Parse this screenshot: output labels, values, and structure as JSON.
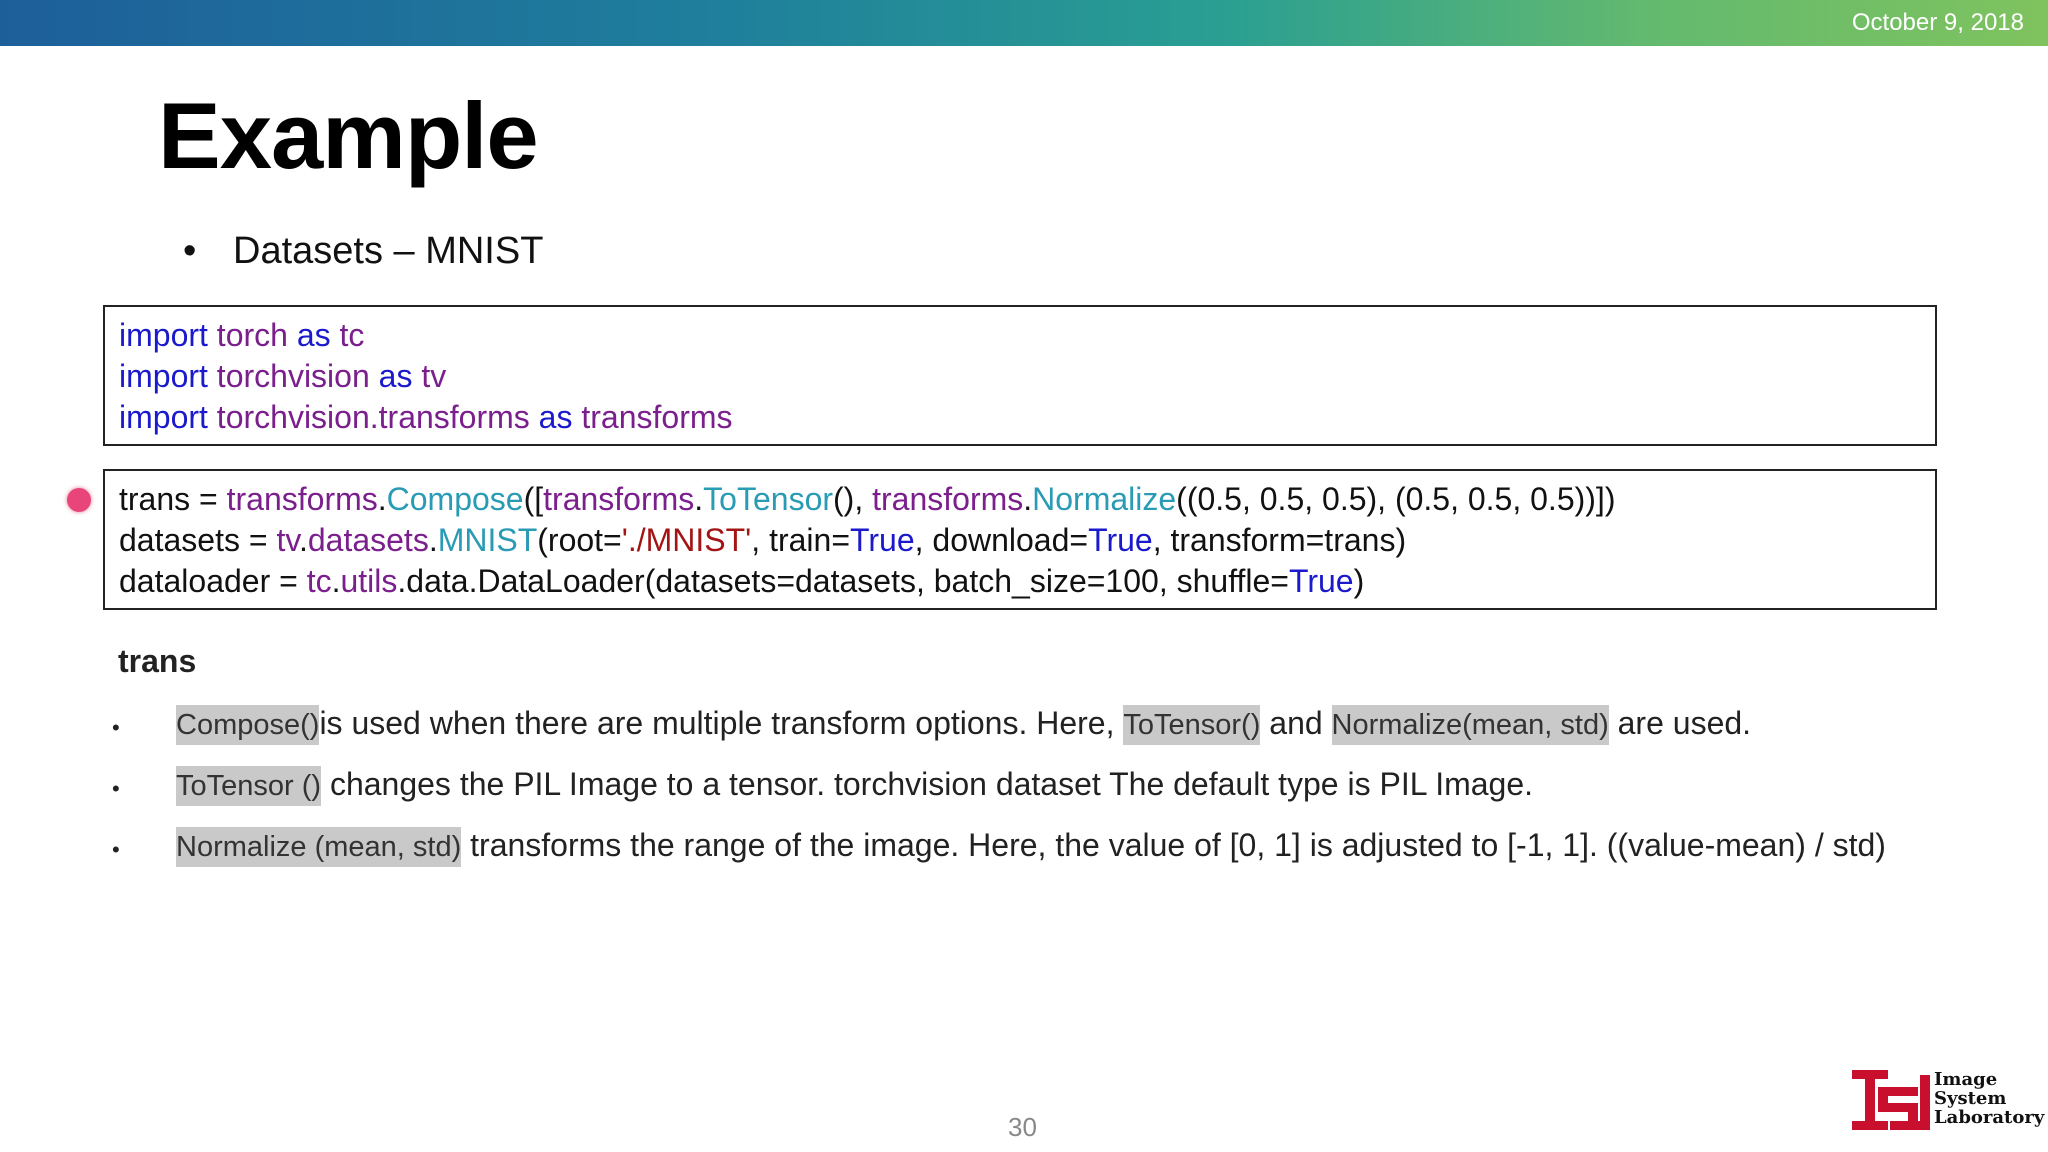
{
  "header": {
    "date": "October 9, 2018"
  },
  "slide": {
    "title": "Example",
    "bullet": "Datasets – MNIST",
    "bullet_marker": "•"
  },
  "code_block_1": {
    "line1": {
      "a": "import",
      "b": " torch ",
      "c": "as",
      "d": " tc"
    },
    "line2": {
      "a": "import",
      "b": " torchvision ",
      "c": "as",
      "d": " tv"
    },
    "line3": {
      "a": "import",
      "b": " torchvision.transforms ",
      "c": "as",
      "d": " transforms"
    }
  },
  "code_block_2": {
    "line1": {
      "t1": "trans = ",
      "t2": "transforms",
      "t3": ".",
      "t4": "Compose",
      "t5": "([",
      "t6": "transforms",
      "t7": ".",
      "t8": "ToTensor",
      "t9": "(), ",
      "t10": "transforms",
      "t11": ".",
      "t12": "Normalize",
      "t13": "((0.5, 0.5, 0.5), (0.5, 0.5, 0.5))])"
    },
    "line2": {
      "t1": "datasets = ",
      "t2": "tv",
      "t3": ".",
      "t4": "datasets",
      "t5": ".",
      "t6": "MNIST",
      "t7": "(root=",
      "t8": "'./MNIST'",
      "t9": ", train=",
      "t10": "True",
      "t11": ", download=",
      "t12": "True",
      "t13": ", transform=trans)"
    },
    "line3": {
      "t1": "dataloader = ",
      "t2": "tc",
      "t3": ".",
      "t4": "utils",
      "t5": ".data.DataLoader(datasets=datasets, batch_size=100, shuffle=",
      "t6": "True",
      "t7": ")"
    }
  },
  "explanation": {
    "heading": "trans",
    "bullet_marker": "•",
    "items": [
      {
        "h1": "Compose()",
        "t1": "is used when there are multiple transform options. Here, ",
        "h2": "ToTensor()",
        "t2": " and ",
        "h3": "Normalize(mean, std)",
        "t3": " are used."
      },
      {
        "h1": "ToTensor ()",
        "t1": " changes the PIL Image to a tensor. torchvision dataset The default type is PIL Image."
      },
      {
        "h1": "Normalize (mean, std)",
        "t1": " transforms the range of the image. Here, the value of [0, 1] is adjusted to [-1, 1]. ((value-mean) / std)"
      }
    ]
  },
  "footer": {
    "page_number": "30",
    "logo": {
      "line1": "Image",
      "line2": "System",
      "line3": "Laboratory",
      "icon": "isl-logo-icon",
      "color": "#c8102e"
    }
  },
  "colors": {
    "keyword": "#1a1acc",
    "module": "#7a1f8c",
    "function": "#2a9bb5",
    "string": "#a31515",
    "highlight": "#c9c9c9",
    "pointer": "#e8457a"
  }
}
